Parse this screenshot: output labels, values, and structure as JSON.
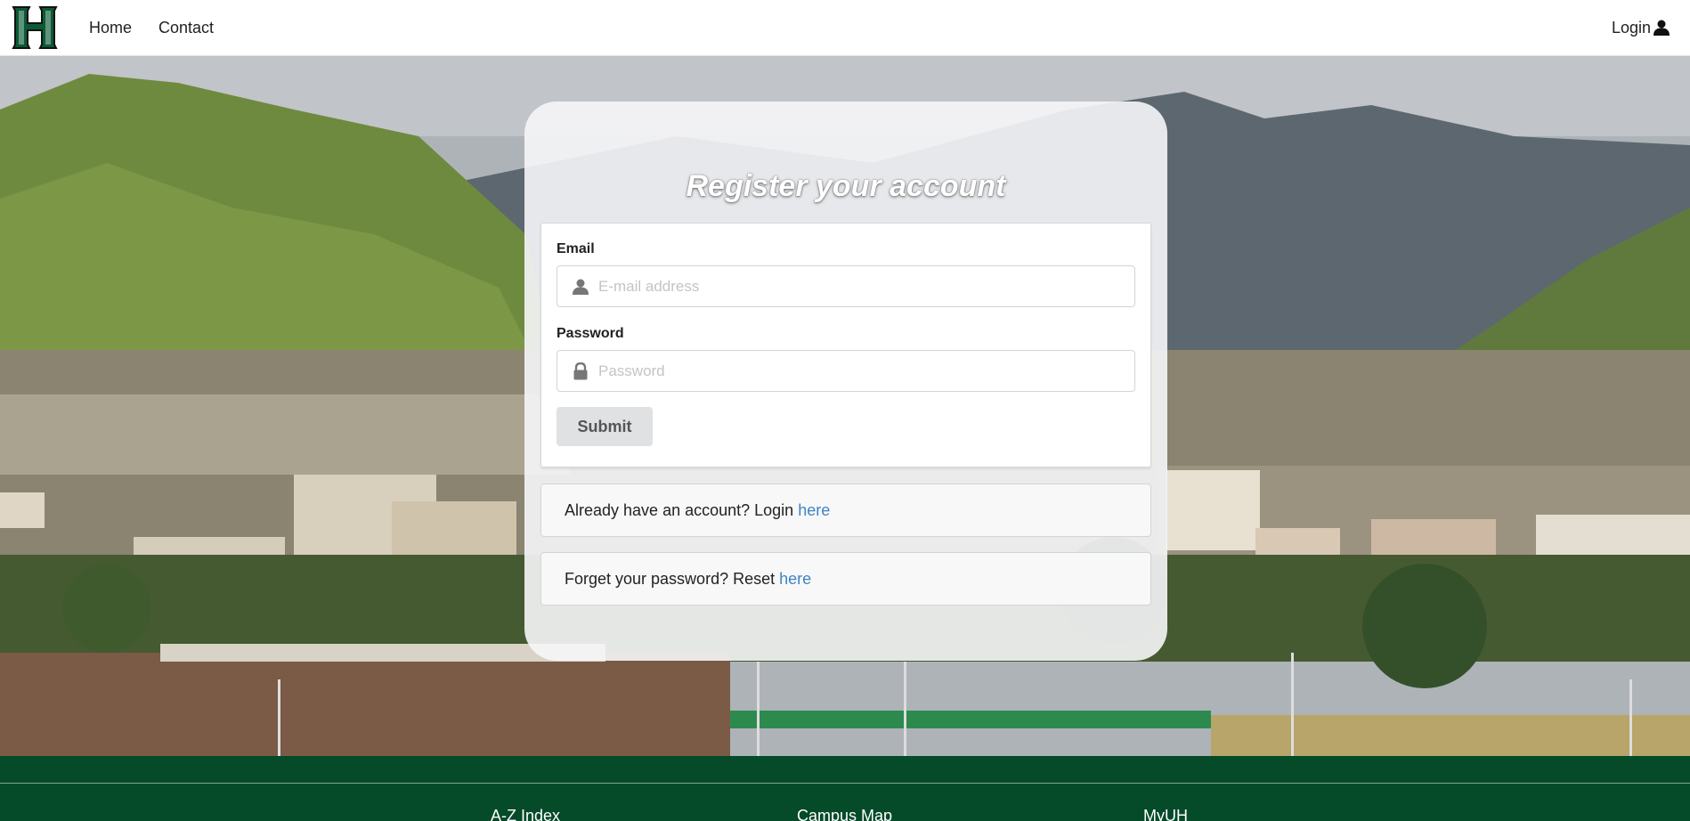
{
  "navbar": {
    "logo_alt": "H",
    "links": [
      {
        "label": "Home"
      },
      {
        "label": "Contact"
      }
    ],
    "login_label": "Login"
  },
  "register": {
    "title": "Register your account",
    "email_label": "Email",
    "email_placeholder": "E-mail address",
    "email_value": "",
    "password_label": "Password",
    "password_placeholder": "Password",
    "password_value": "",
    "submit_label": "Submit"
  },
  "messages": {
    "login_text": "Already have an account? Login",
    "login_link": "here",
    "reset_text": "Forget your password? Reset",
    "reset_link": "here"
  },
  "footer": {
    "links": [
      "A-Z Index",
      "Campus Map",
      "MyUH"
    ]
  },
  "colors": {
    "brand_green": "#054a29",
    "link_blue": "#4183c4"
  },
  "icons": {
    "logo": "uh-h-logo",
    "login": "user-icon",
    "email": "user-icon",
    "password": "lock-icon"
  }
}
